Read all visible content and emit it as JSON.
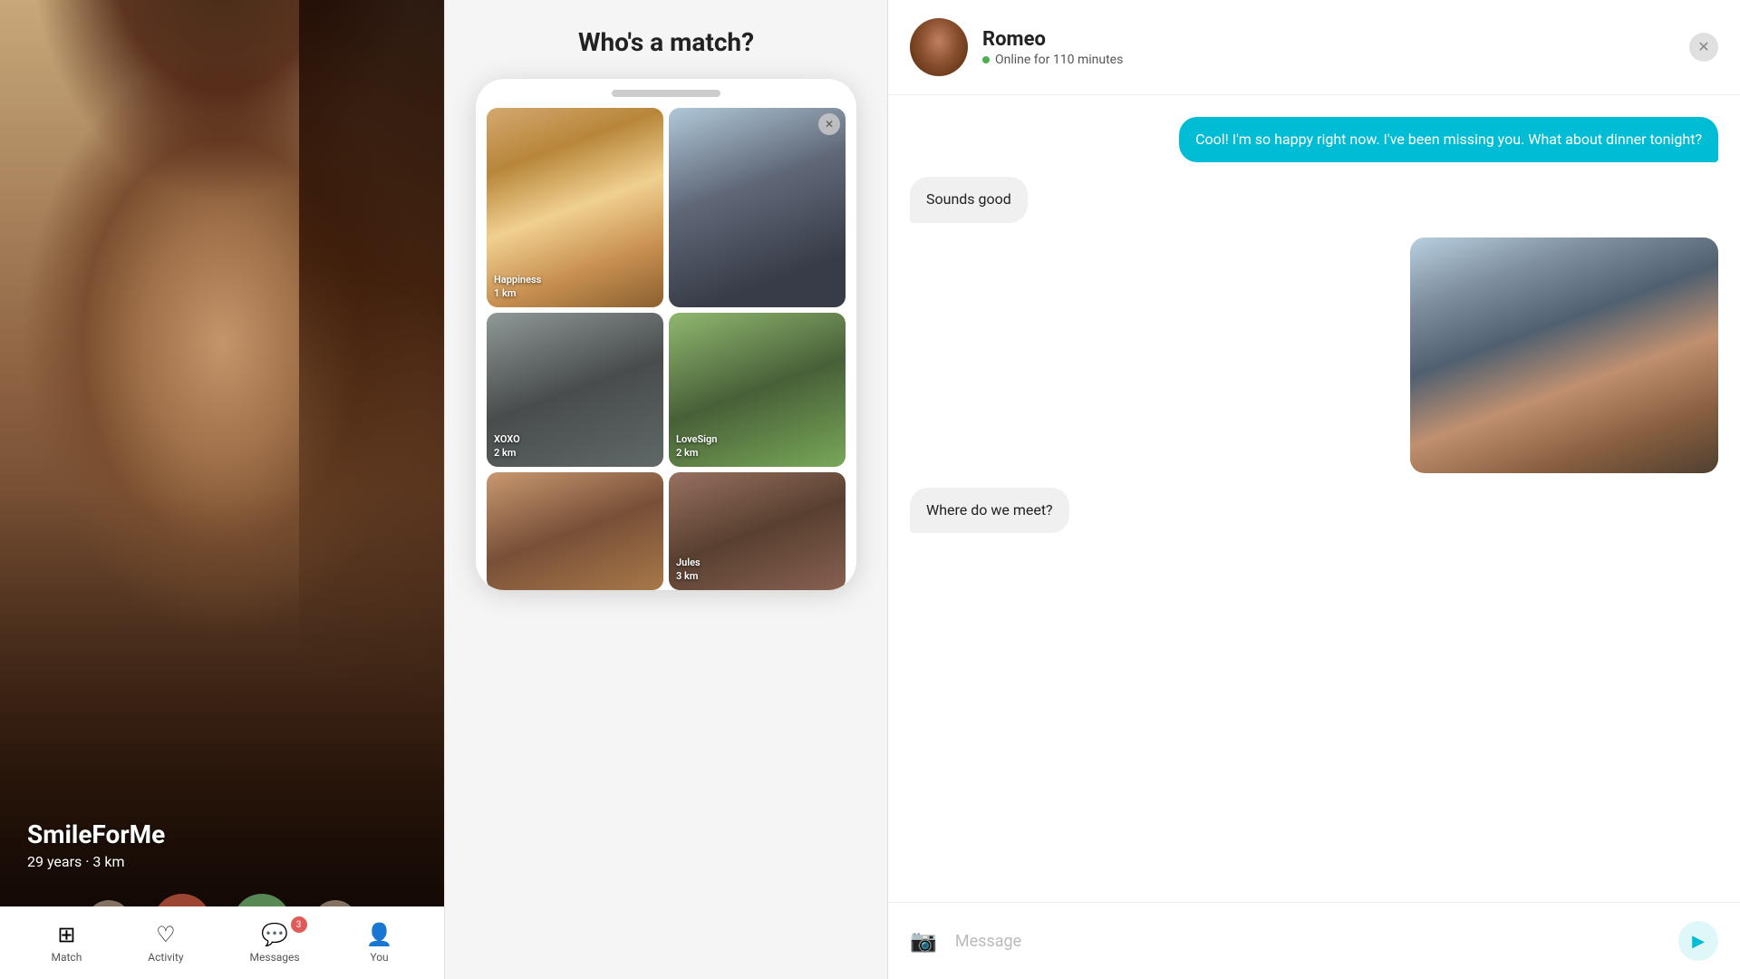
{
  "panel1": {
    "profile_name": "SmileForMe",
    "profile_meta": "29 years · 3 km",
    "actions": {
      "rewind": "↩",
      "reject": "✕",
      "accept": "✓",
      "boost": "🚀"
    },
    "nav": [
      {
        "label": "Match",
        "icon": "⊞",
        "active": true
      },
      {
        "label": "Activity",
        "icon": "♡"
      },
      {
        "label": "Messages",
        "icon": "💬",
        "badge": "3"
      },
      {
        "label": "You",
        "icon": "👤"
      }
    ]
  },
  "panel2": {
    "title": "Who's a match?",
    "cards": [
      {
        "name": "Happiness",
        "distance": "1 km",
        "color": "man1",
        "size": "tall",
        "hasClose": false
      },
      {
        "name": "",
        "distance": "",
        "color": "man2",
        "size": "tall",
        "hasClose": true
      },
      {
        "name": "XOXO",
        "distance": "2 km",
        "color": "man3",
        "size": "medium"
      },
      {
        "name": "LoveSign",
        "distance": "2 km",
        "color": "man4",
        "size": "medium"
      },
      {
        "name": "",
        "distance": "",
        "color": "man5",
        "size": "short"
      },
      {
        "name": "Jules",
        "distance": "3 km",
        "color": "man6",
        "size": "short"
      }
    ]
  },
  "panel3": {
    "username": "Romeo",
    "status": "Online for 110 minutes",
    "messages": [
      {
        "type": "sent",
        "text": "Cool! I'm so happy right now. I've been missing you. What about dinner tonight?"
      },
      {
        "type": "received",
        "text": "Sounds good"
      },
      {
        "type": "image",
        "text": "[photo]"
      },
      {
        "type": "received",
        "text": "Where do we meet?"
      }
    ],
    "footer": {
      "placeholder": "Message",
      "camera_icon": "📷",
      "send_icon": "▶"
    }
  }
}
